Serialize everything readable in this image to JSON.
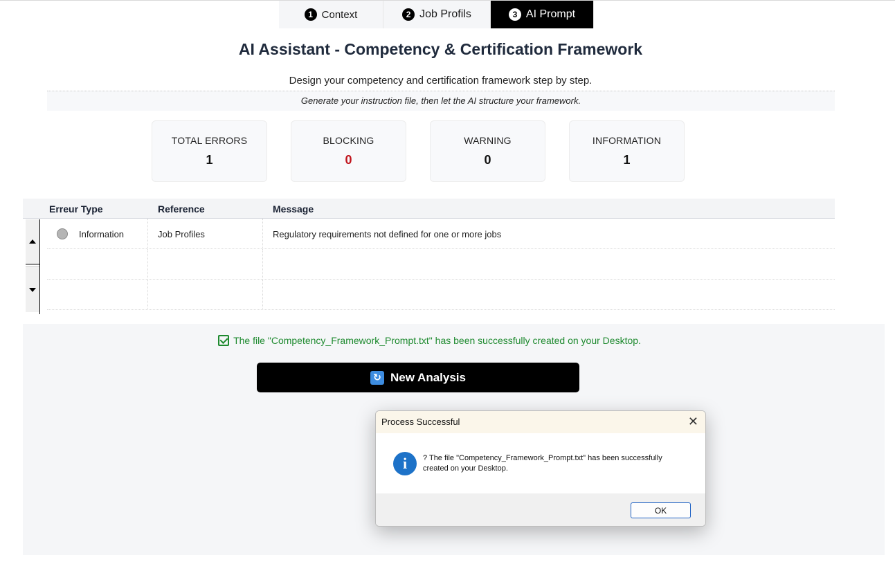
{
  "tabs": [
    {
      "num": "1",
      "label": "Context"
    },
    {
      "num": "2",
      "label": "Job Profils"
    },
    {
      "num": "3",
      "label": "AI Prompt"
    }
  ],
  "header": {
    "title": "AI Assistant - Competency & Certification Framework",
    "subtitle": "Design your competency and certification framework step by step.",
    "note": "Generate your instruction file, then let the AI structure your framework."
  },
  "stats": [
    {
      "label": "TOTAL ERRORS",
      "value": "1"
    },
    {
      "label": "BLOCKING",
      "value": "0"
    },
    {
      "label": "WARNING",
      "value": "0"
    },
    {
      "label": "INFORMATION",
      "value": "1"
    }
  ],
  "table": {
    "headers": [
      "Erreur Type",
      "Reference",
      "Message"
    ],
    "rows": [
      {
        "type": "Information",
        "reference": "Job Profiles",
        "message": "Regulatory requirements not defined for one or more jobs"
      }
    ]
  },
  "status": {
    "success_message": "The file \"Competency_Framework_Prompt.txt\" has been successfully created on your Desktop."
  },
  "actions": {
    "new_analysis": "New Analysis"
  },
  "dialog": {
    "title": "Process Successful",
    "message_line1": "? The file \"Competency_Framework_Prompt.txt\" has been successfully",
    "message_line2": "created on your Desktop.",
    "ok_label": "OK"
  },
  "colors": {
    "blocking_value": "#c0141c",
    "success": "#1e8a2f",
    "active_tab": "#000000"
  }
}
